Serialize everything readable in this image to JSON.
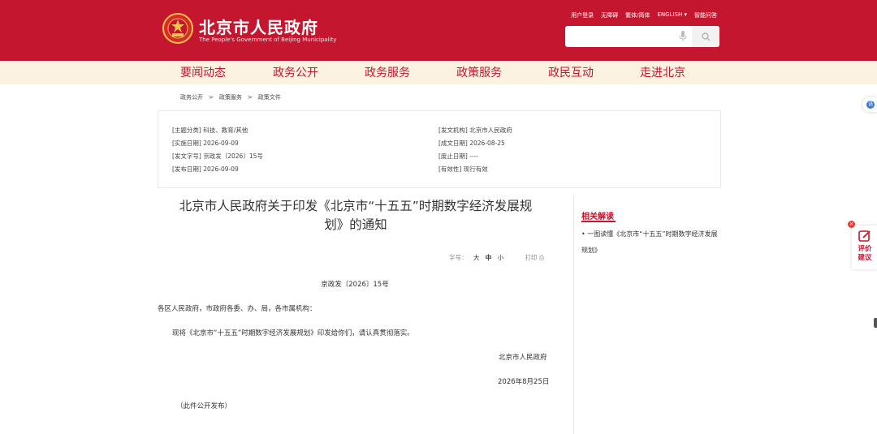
{
  "header": {
    "site_name_cn": "北京市人民政府",
    "site_name_en": "The People's Government of Beijing Municipality",
    "top_links": [
      "用户登录",
      "无障碍",
      "繁体/简体",
      "ENGLISH",
      "智能问答"
    ],
    "search_placeholder": ""
  },
  "nav": {
    "items": [
      "要闻动态",
      "政务公开",
      "政务服务",
      "政策服务",
      "政民互动",
      "走进北京"
    ]
  },
  "breadcrumb": [
    "政务公开",
    "政策服务",
    "政策文件"
  ],
  "meta": {
    "left": [
      "[主题分类] 科技、教育/其他",
      "[实施日期] 2026-09-09",
      "[发文字号] 京政发〔2026〕15号",
      "[发布日期] 2026-09-09"
    ],
    "right": [
      "[发文机构] 北京市人民政府",
      "[成文日期] 2026-08-25",
      "[废止日期] ----",
      "[有效性] 现行有效"
    ]
  },
  "article": {
    "title_line1": "北京市人民政府关于印发《北京市“十五五”时期数字经济发展规",
    "title_line2": "划》的通知",
    "font_label": "字号：",
    "size_large": "大",
    "size_medium": "中",
    "size_small": "小",
    "print_label": "打印",
    "doc_number": "京政发〔2026〕15号",
    "salutation": "各区人民政府，市政府各委、办、局，各市属机构：",
    "body": "现将《北京市“十五五”时期数字经济发展规划》印发给你们，请认真贯彻落实。",
    "signature": "北京市人民政府",
    "date": "2026年8月25日",
    "note": "（此件公开发布）"
  },
  "related": {
    "title": "相关解读",
    "items": [
      "• 一图读懂《北京市“十五五”时期数字经济发展规划》"
    ]
  },
  "float": {
    "top_icon_text": "语",
    "eval_label": "评价建议",
    "close_text": "×"
  },
  "colors": {
    "brand_red": "#c4162f",
    "nav_bg": "#fcf2e1"
  }
}
